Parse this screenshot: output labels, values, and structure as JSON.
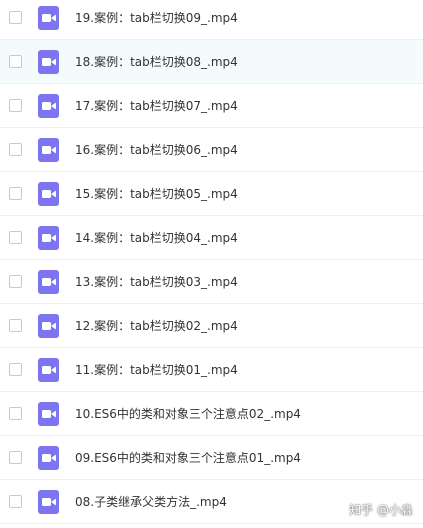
{
  "files": [
    {
      "name": "19.案例：tab栏切换09_.mp4",
      "icon": "video-icon"
    },
    {
      "name": "18.案例：tab栏切换08_.mp4",
      "icon": "video-icon"
    },
    {
      "name": "17.案例：tab栏切换07_.mp4",
      "icon": "video-icon"
    },
    {
      "name": "16.案例：tab栏切换06_.mp4",
      "icon": "video-icon"
    },
    {
      "name": "15.案例：tab栏切换05_.mp4",
      "icon": "video-icon"
    },
    {
      "name": "14.案例：tab栏切换04_.mp4",
      "icon": "video-icon"
    },
    {
      "name": "13.案例：tab栏切换03_.mp4",
      "icon": "video-icon"
    },
    {
      "name": "12.案例：tab栏切换02_.mp4",
      "icon": "video-icon"
    },
    {
      "name": "11.案例：tab栏切换01_.mp4",
      "icon": "video-icon"
    },
    {
      "name": "10.ES6中的类和对象三个注意点02_.mp4",
      "icon": "video-icon"
    },
    {
      "name": "09.ES6中的类和对象三个注意点01_.mp4",
      "icon": "video-icon"
    },
    {
      "name": "08.子类继承父类方法_.mp4",
      "icon": "video-icon"
    }
  ],
  "watermark": "知乎 @小淼",
  "colors": {
    "icon_bg": "#7c74f0",
    "hover_row": "#f4fbfd"
  }
}
